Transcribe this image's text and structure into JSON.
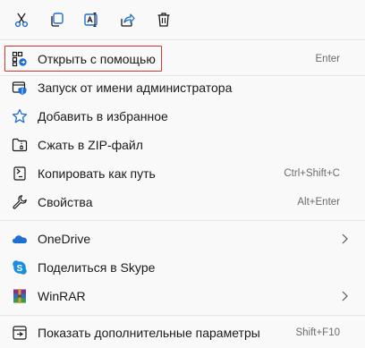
{
  "toolbar": {
    "buttons": [
      {
        "icon": "cut-icon",
        "label": "Cut"
      },
      {
        "icon": "copy-icon",
        "label": "Copy"
      },
      {
        "icon": "rename-icon",
        "label": "Rename"
      },
      {
        "icon": "share-icon",
        "label": "Share"
      },
      {
        "icon": "delete-icon",
        "label": "Delete"
      }
    ]
  },
  "colors": {
    "accent": "#1f6fd1",
    "highlight_border": "#d9342b",
    "background": "#f9f9f9"
  },
  "items": [
    {
      "icon": "open-with-icon",
      "label": "Открыть с помощью",
      "shortcut": "Enter",
      "highlighted": true
    },
    {
      "icon": "admin-shield-icon",
      "label": "Запуск от имени администратора",
      "shortcut": ""
    },
    {
      "icon": "star-icon",
      "label": "Добавить в избранное",
      "shortcut": ""
    },
    {
      "icon": "zip-folder-icon",
      "label": "Сжать в ZIP-файл",
      "shortcut": ""
    },
    {
      "icon": "copy-path-icon",
      "label": "Копировать как путь",
      "shortcut": "Ctrl+Shift+C"
    },
    {
      "icon": "properties-wrench-icon",
      "label": "Свойства",
      "shortcut": "Alt+Enter"
    },
    {
      "icon": "onedrive-cloud-icon",
      "label": "OneDrive",
      "shortcut": "",
      "submenu": true
    },
    {
      "icon": "skype-icon",
      "label": "Поделиться в Skype",
      "shortcut": ""
    },
    {
      "icon": "winrar-icon",
      "label": "WinRAR",
      "shortcut": "",
      "submenu": true
    },
    {
      "icon": "more-options-icon",
      "label": "Показать дополнительные параметры",
      "shortcut": "Shift+F10"
    }
  ]
}
